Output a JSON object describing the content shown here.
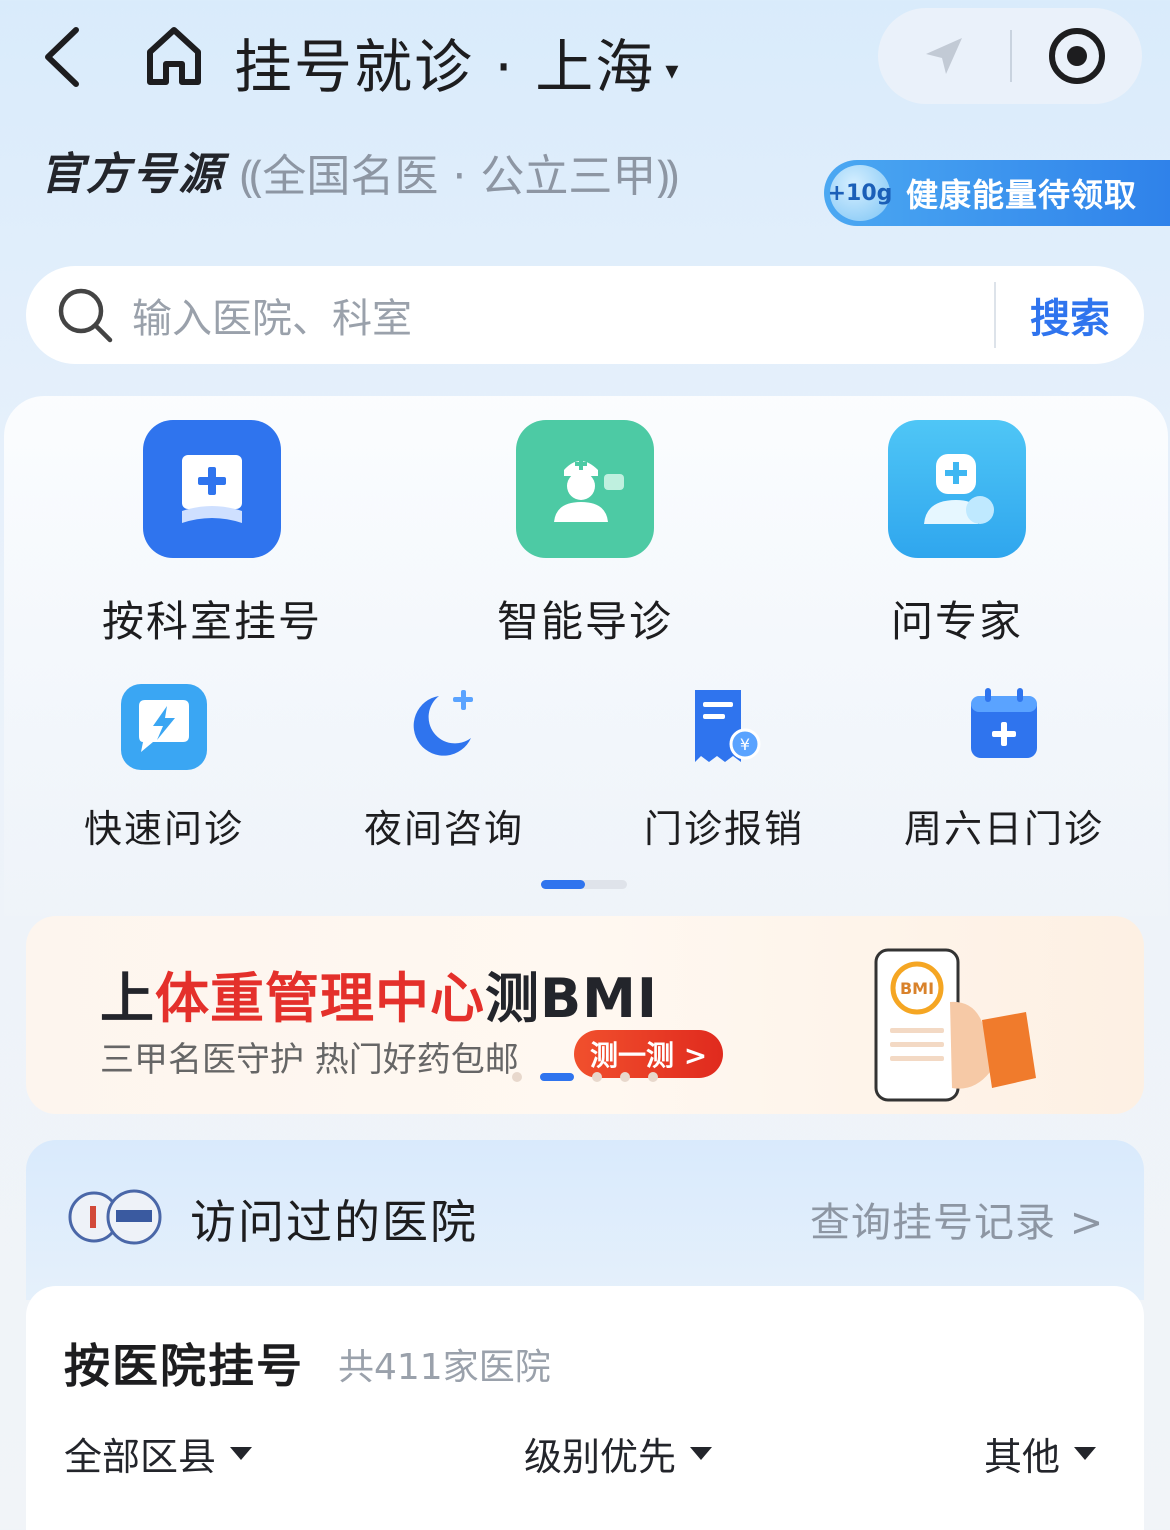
{
  "header": {
    "title": "挂号就诊 · 上海",
    "city_caret": "▾"
  },
  "tagline": {
    "official": "官方号源",
    "sub": "全国名医 · 公立三甲"
  },
  "energy": {
    "bubble": "+10g",
    "label": "健康能量待领取"
  },
  "search": {
    "placeholder": "输入医院、科室",
    "button": "搜索"
  },
  "services": {
    "main": [
      {
        "label": "按科室挂号",
        "icon": "department-register-icon",
        "color": "#2f74ee"
      },
      {
        "label": "智能导诊",
        "icon": "nurse-icon",
        "color": "#4dcaa4"
      },
      {
        "label": "问专家",
        "icon": "expert-icon",
        "color": "#3fb7f2"
      }
    ],
    "secondary": [
      {
        "label": "快速问诊",
        "icon": "lightning-chat-icon"
      },
      {
        "label": "夜间咨询",
        "icon": "moon-icon"
      },
      {
        "label": "门诊报销",
        "icon": "receipt-icon"
      },
      {
        "label": "周六日门诊",
        "icon": "calendar-icon"
      }
    ]
  },
  "banner": {
    "title_pre": "上",
    "title_red": "体重管理中心",
    "title_post": "测BMI",
    "subtitle": "三甲名医守护 热门好药包邮",
    "cta": "测一测 >",
    "phone_text": "BMI"
  },
  "visited": {
    "title": "访问过的医院",
    "link": "查询挂号记录 >"
  },
  "hospital_list": {
    "title": "按医院挂号",
    "count": "共411家医院",
    "filters": [
      "全部区县",
      "级别优先",
      "其他"
    ]
  },
  "colors": {
    "accent": "#2f74ee",
    "promo_red": "#e4302b"
  }
}
